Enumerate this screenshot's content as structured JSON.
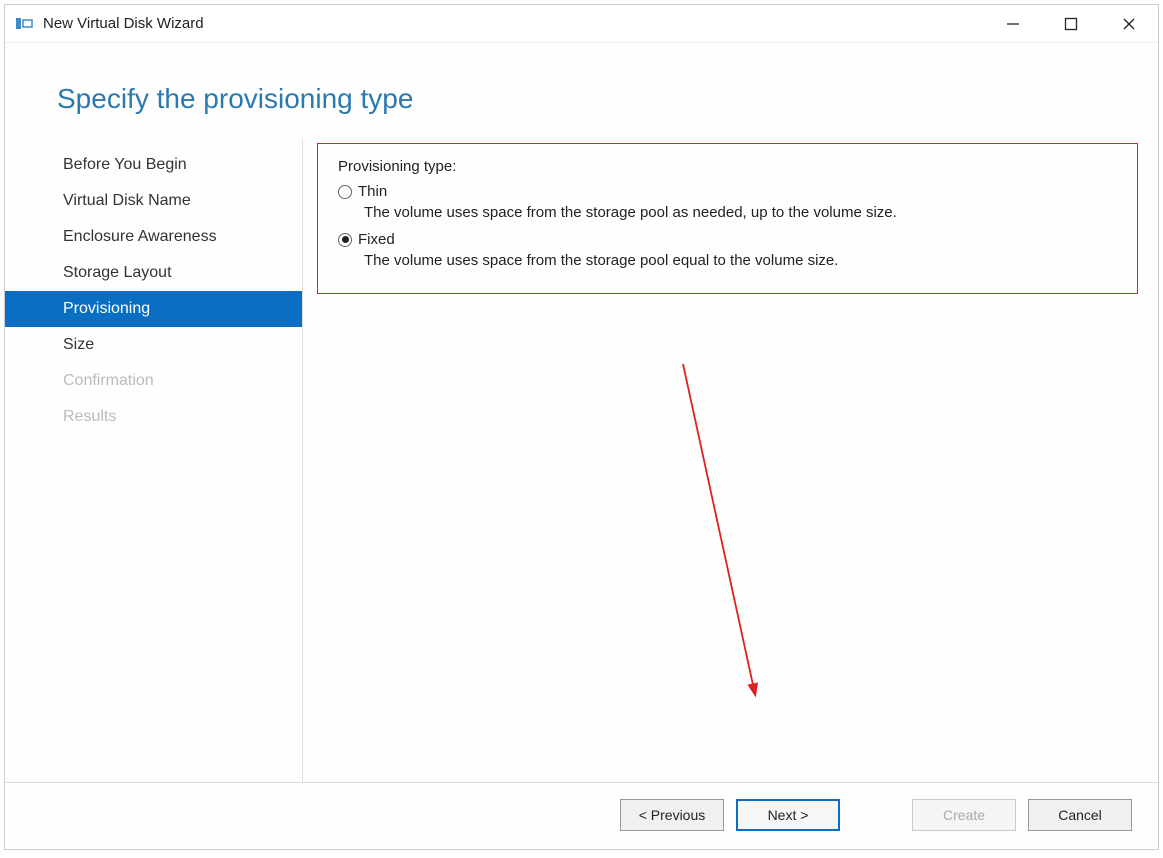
{
  "window": {
    "title": "New Virtual Disk Wizard"
  },
  "page": {
    "heading": "Specify the provisioning type"
  },
  "sidebar": {
    "items": [
      {
        "label": "Before You Begin",
        "state": "normal"
      },
      {
        "label": "Virtual Disk Name",
        "state": "normal"
      },
      {
        "label": "Enclosure Awareness",
        "state": "normal"
      },
      {
        "label": "Storage Layout",
        "state": "normal"
      },
      {
        "label": "Provisioning",
        "state": "active"
      },
      {
        "label": "Size",
        "state": "normal"
      },
      {
        "label": "Confirmation",
        "state": "disabled"
      },
      {
        "label": "Results",
        "state": "disabled"
      }
    ]
  },
  "provisioning": {
    "group_label": "Provisioning type:",
    "options": [
      {
        "label": "Thin",
        "checked": false,
        "description": "The volume uses space from the storage pool as needed, up to the volume size."
      },
      {
        "label": "Fixed",
        "checked": true,
        "description": "The volume uses space from the storage pool equal to the volume size."
      }
    ]
  },
  "footer": {
    "previous": "< Previous",
    "next": "Next >",
    "create": "Create",
    "cancel": "Cancel"
  }
}
